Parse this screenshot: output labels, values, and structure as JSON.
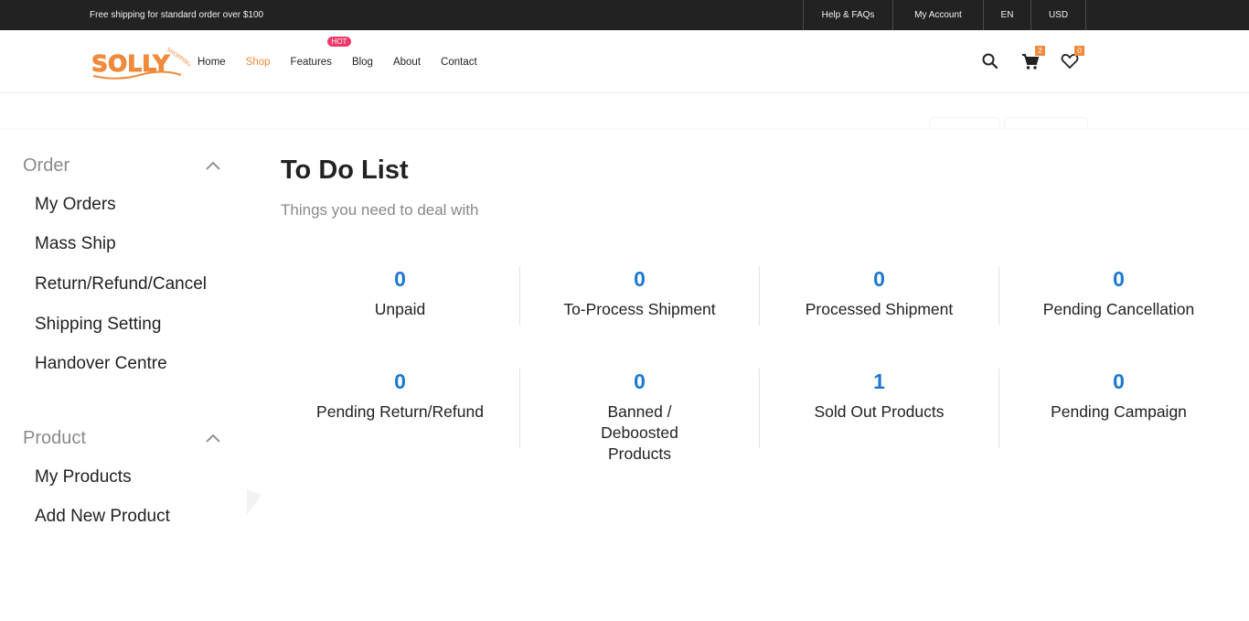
{
  "topbar": {
    "promo": "Free shipping for standard order over $100",
    "help": "Help & FAQs",
    "account": "My Account",
    "language": "EN",
    "currency": "USD"
  },
  "header": {
    "logo_text": "SOLLY",
    "logo_subtext": "SHOPPING",
    "nav": [
      {
        "label": "Home"
      },
      {
        "label": "Shop"
      },
      {
        "label": "Features",
        "badge": "HOT"
      },
      {
        "label": "Blog"
      },
      {
        "label": "About"
      },
      {
        "label": "Contact"
      }
    ],
    "cart_count": "2",
    "wishlist_count": "0",
    "accent_color": "#f08a3c",
    "hot_color": "#f0386b"
  },
  "sidebar": {
    "order": {
      "title": "Order",
      "items": [
        "My Orders",
        "Mass Ship",
        "Return/Refund/Cancel",
        "Shipping Setting",
        "Handover Centre"
      ]
    },
    "product": {
      "title": "Product",
      "items": [
        "My Products",
        "Add New Product"
      ]
    }
  },
  "main": {
    "title": "To Do List",
    "subtitle": "Things you need to deal with",
    "value_color": "#1c78d0",
    "stats": [
      {
        "value": "0",
        "label": "Unpaid"
      },
      {
        "value": "0",
        "label": "To-Process Shipment"
      },
      {
        "value": "0",
        "label": "Processed Shipment"
      },
      {
        "value": "0",
        "label": "Pending Cancellation"
      },
      {
        "value": "0",
        "label": "Pending Return/Refund"
      },
      {
        "value": "0",
        "label": "Banned / Deboosted Products"
      },
      {
        "value": "1",
        "label": "Sold Out Products"
      },
      {
        "value": "0",
        "label": "Pending Campaign"
      }
    ]
  }
}
